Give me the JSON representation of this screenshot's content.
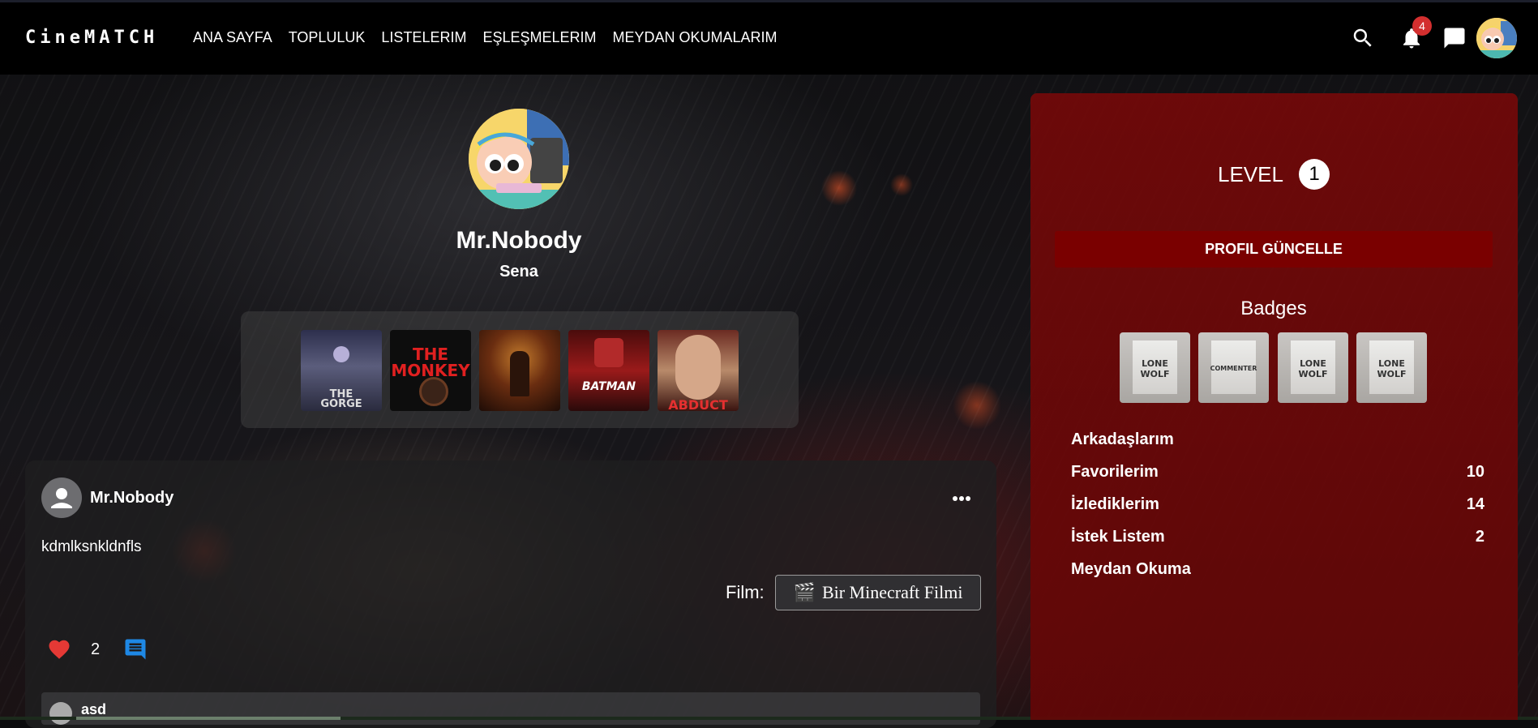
{
  "brand": {
    "logo": "CineMATCH"
  },
  "nav": {
    "links": [
      "ANA SAYFA",
      "TOPLULUK",
      "LISTELERIM",
      "EŞLEŞMELERIM",
      "MEYDAN OKUMALARIM"
    ],
    "notification_count": "4"
  },
  "profile": {
    "username": "Mr.Nobody",
    "name": "Sena",
    "favorites": [
      {
        "text": "THE\nGORGE",
        "bg": "#3b3d5a"
      },
      {
        "text": "THE\nMONKEY",
        "bg": "#0d0d0d"
      },
      {
        "text": "",
        "bg": "#5a2d14"
      },
      {
        "text": "BATMAN",
        "bg": "#7d1414"
      },
      {
        "text": "ABDUCT",
        "bg": "#6d2a1f"
      }
    ]
  },
  "post": {
    "author": "Mr.Nobody",
    "content": "kdmlksnkldnfls",
    "film_label": "Film:",
    "film_icon": "🎬",
    "film_title": "Bir Minecraft Filmi",
    "like_count": "2",
    "comment": {
      "author": "asd"
    }
  },
  "side": {
    "level_label": "LEVEL",
    "level_value": "1",
    "update_button": "PROFIL GÜNCELLE",
    "badges_title": "Badges",
    "badges": [
      {
        "label": "LONE\nWOLF"
      },
      {
        "label": "COMMENTER"
      },
      {
        "label": "LONE\nWOLF"
      },
      {
        "label": "LONE\nWOLF"
      }
    ],
    "stats": [
      {
        "label": "Arkadaşlarım",
        "value": ""
      },
      {
        "label": "Favorilerim",
        "value": "10"
      },
      {
        "label": "İzlediklerim",
        "value": "14"
      },
      {
        "label": "İstek Listem",
        "value": "2"
      },
      {
        "label": "Meydan Okuma",
        "value": ""
      }
    ]
  },
  "colors": {
    "panel": "#7a0808",
    "button": "#7a0000",
    "heart": "#e53935",
    "comment_icon": "#1e88e5",
    "notification_badge": "#d32f2f"
  }
}
